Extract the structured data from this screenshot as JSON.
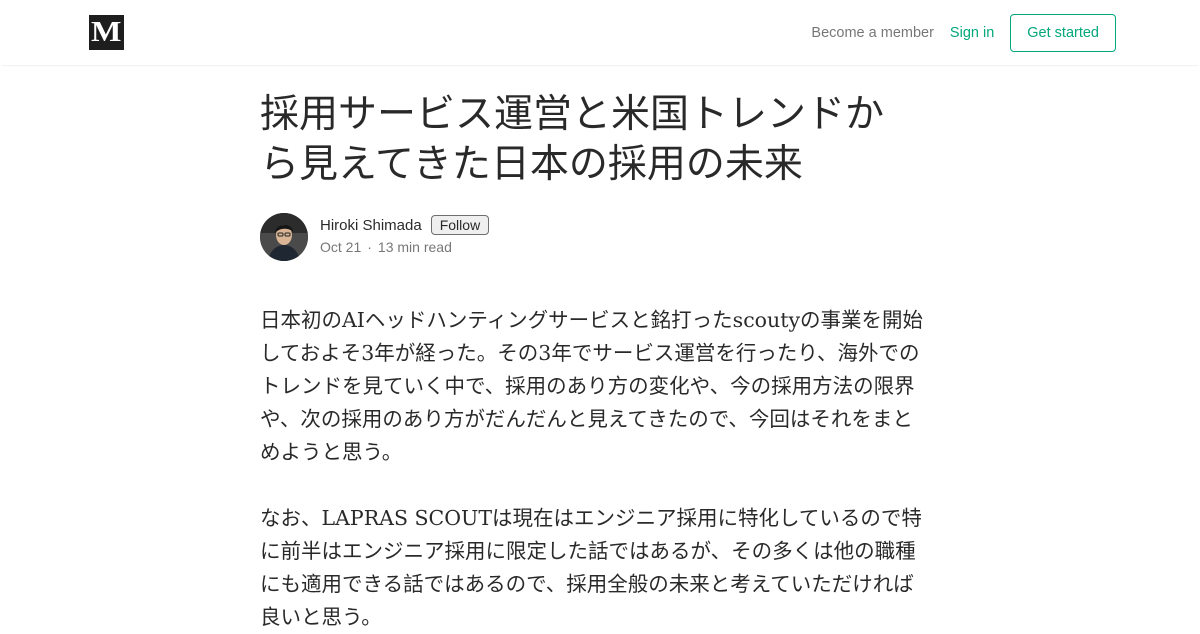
{
  "header": {
    "logo_letter": "M",
    "become_member": "Become a member",
    "sign_in": "Sign in",
    "get_started": "Get started"
  },
  "article": {
    "title": "採用サービス運営と米国トレンドから見えてきた日本の採用の未来",
    "author": "Hiroki Shimada",
    "follow_label": "Follow",
    "date": "Oct 21",
    "separator": "·",
    "read_time": "13 min read",
    "paragraphs": [
      "日本初のAIヘッドハンティングサービスと銘打ったscoutyの事業を開始しておよそ3年が経った。その3年でサービス運営を行ったり、海外でのトレンドを見ていく中で、採用のあり方の変化や、今の採用方法の限界や、次の採用のあり方がだんだんと見えてきたので、今回はそれをまとめようと思う。",
      "なお、LAPRAS SCOUTは現在はエンジニア採用に特化しているので特に前半はエンジニア採用に限定した話ではあるが、その多くは他の職種にも適用できる話ではあるので、採用全般の未来と考えていただければ良いと思う。"
    ]
  },
  "colors": {
    "accent": "#03a87c",
    "logo_bg": "#1e1e1e",
    "text": "rgba(0,0,0,0.84)",
    "muted": "rgba(0,0,0,0.54)"
  }
}
